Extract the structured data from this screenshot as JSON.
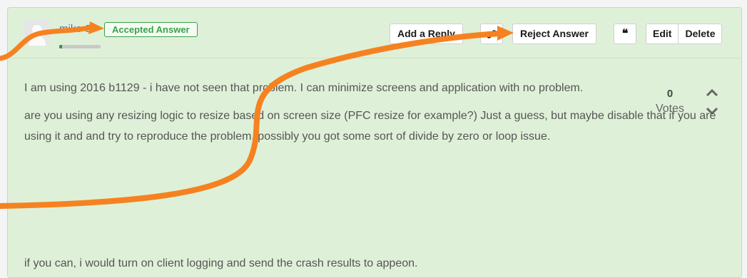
{
  "post": {
    "username": "mike S",
    "badge": "Accepted Answer",
    "reputation_fraction": 0.07
  },
  "actions": {
    "add_reply": "Add a Reply",
    "reject_answer": "Reject Answer",
    "quote": "❝",
    "edit": "Edit",
    "delete": "Delete"
  },
  "votes": {
    "count": "0",
    "label": "Votes"
  },
  "content": {
    "p1": "I am using 2016 b1129 - i have not seen that problem.  I can minimize screens and application with no problem.",
    "p2": "are you using any resizing logic to resize based on screen size (PFC resize for example?)  Just a guess, but maybe disable that if you are using it and and try to reproduce the problem.  possibly you got some sort of divide by zero or loop issue.",
    "p3": "if you can, i would turn on client logging and send the crash results to appeon."
  },
  "colors": {
    "accent_green": "#3aa14a",
    "annotation_orange": "#f58220",
    "link_blue": "#3b77b8"
  },
  "icons": {
    "link": "link-icon",
    "quote": "quote-icon",
    "upvote": "chevron-up-icon",
    "downvote": "chevron-down-icon",
    "avatar": "user-avatar-icon"
  }
}
